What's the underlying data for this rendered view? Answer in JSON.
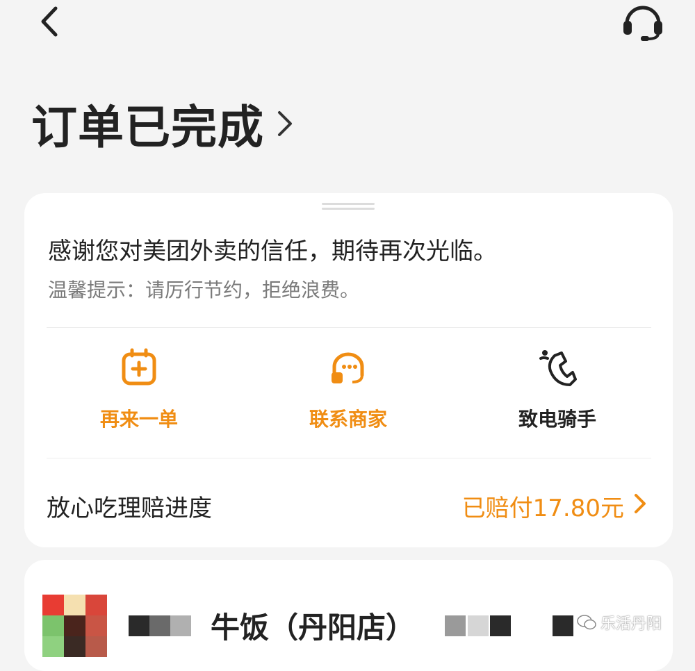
{
  "header": {
    "back_icon": "chevron-left-icon",
    "support_icon": "headset-icon"
  },
  "status": {
    "title": "订单已完成"
  },
  "card": {
    "thanks": "感谢您对美团外卖的信任，期待再次光临。",
    "tip": "温馨提示：请厉行节约，拒绝浪费。",
    "actions": [
      {
        "label": "再来一单",
        "icon": "reorder-icon",
        "color": "#f08d13"
      },
      {
        "label": "联系商家",
        "icon": "merchant-chat-icon",
        "color": "#f08d13"
      },
      {
        "label": "致电骑手",
        "icon": "phone-icon",
        "color": "#222222"
      }
    ],
    "claim": {
      "label": "放心吃理赔进度",
      "status": "已赔付17.80元"
    }
  },
  "store": {
    "name": "牛饭（丹阳店）"
  },
  "watermark": {
    "text": "乐活丹阳"
  },
  "colors": {
    "accent": "#f08d13",
    "background": "#f4f4f4",
    "card": "#ffffff"
  }
}
